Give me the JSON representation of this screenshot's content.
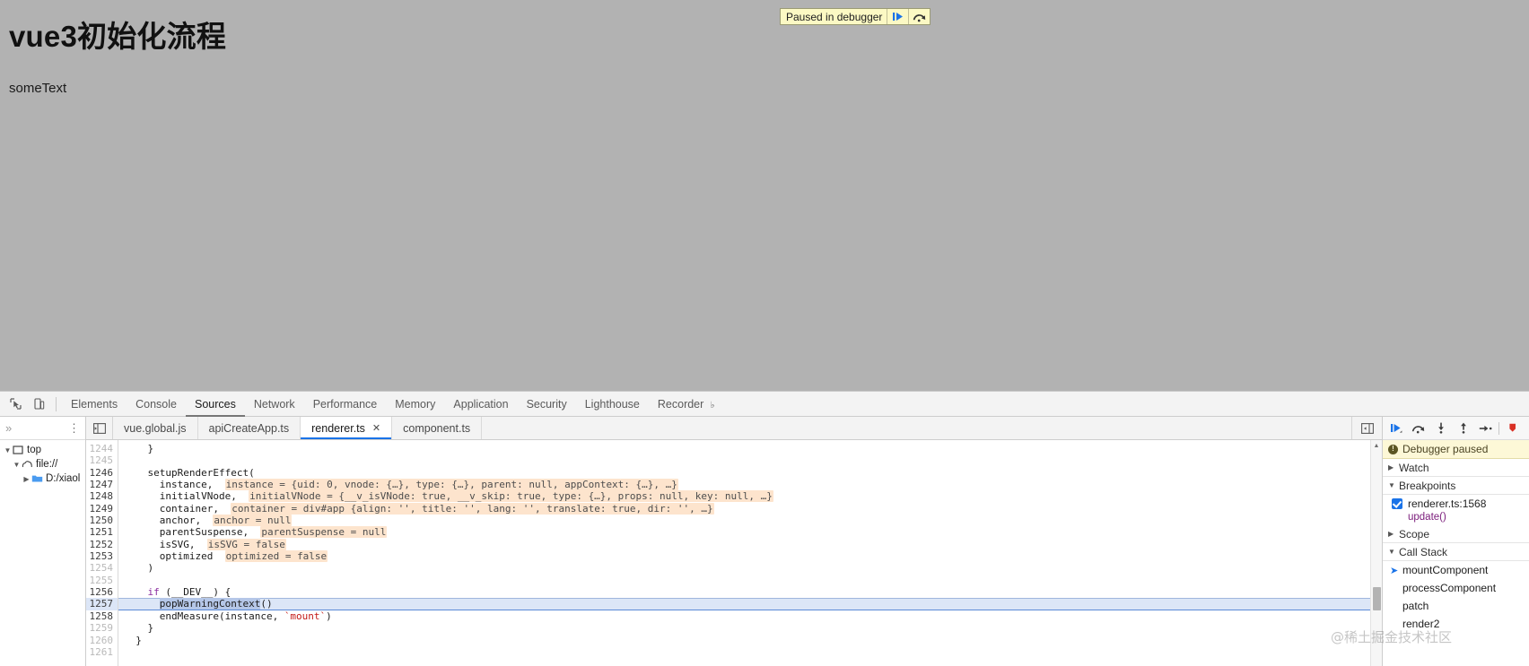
{
  "page": {
    "title": "vue3初始化流程",
    "body_text": "someText",
    "background_color": "#b2b2b2"
  },
  "paused_overlay": {
    "label": "Paused in debugger",
    "resume_icon": "resume-icon",
    "step_over_icon": "step-over-icon",
    "background_color": "#fcf9c4"
  },
  "devtools": {
    "toolbar": {
      "inspect_icon": "inspect-element-icon",
      "device_icon": "device-toolbar-icon",
      "tabs": [
        {
          "label": "Elements",
          "active": false
        },
        {
          "label": "Console",
          "active": false
        },
        {
          "label": "Sources",
          "active": true
        },
        {
          "label": "Network",
          "active": false
        },
        {
          "label": "Performance",
          "active": false
        },
        {
          "label": "Memory",
          "active": false
        },
        {
          "label": "Application",
          "active": false
        },
        {
          "label": "Security",
          "active": false
        },
        {
          "label": "Lighthouse",
          "active": false
        },
        {
          "label": "Recorder",
          "active": false,
          "badge": "experiment-flask-icon"
        }
      ]
    },
    "navigator": {
      "more_icon": "chevron-double-right-icon",
      "menu_icon": "more-options-icon",
      "tree": [
        {
          "label": "top",
          "depth": 0,
          "twisty": "▼",
          "icon": "frame-icon"
        },
        {
          "label": "file://",
          "depth": 1,
          "twisty": "▼",
          "icon": "cloud-icon"
        },
        {
          "label": "D:/xiaol",
          "depth": 2,
          "twisty": "▶",
          "icon": "folder-icon"
        }
      ]
    },
    "editor": {
      "panel_left_icon": "navigator-toggle-icon",
      "panel_right_icon": "debugger-toggle-icon",
      "file_tabs": [
        {
          "label": "vue.global.js",
          "active": false,
          "closable": false
        },
        {
          "label": "apiCreateApp.ts",
          "active": false,
          "closable": false
        },
        {
          "label": "renderer.ts",
          "active": true,
          "closable": true,
          "close_label": "✕"
        },
        {
          "label": "component.ts",
          "active": false,
          "closable": false
        }
      ],
      "current_line": 1257,
      "lines": [
        {
          "n": 1244,
          "dim": true,
          "code": "    }"
        },
        {
          "n": 1245,
          "dim": true,
          "code": ""
        },
        {
          "n": 1246,
          "dim": false,
          "code": "    setupRenderEffect("
        },
        {
          "n": 1247,
          "dim": false,
          "code": "      instance,",
          "value": "instance = {uid: 0, vnode: {…}, type: {…}, parent: null, appContext: {…}, …}"
        },
        {
          "n": 1248,
          "dim": false,
          "code": "      initialVNode,",
          "value": "initialVNode = {__v_isVNode: true, __v_skip: true, type: {…}, props: null, key: null, …}"
        },
        {
          "n": 1249,
          "dim": false,
          "code": "      container,",
          "value": "container = div#app {align: '', title: '', lang: '', translate: true, dir: '', …}"
        },
        {
          "n": 1250,
          "dim": false,
          "code": "      anchor,",
          "value": "anchor = null"
        },
        {
          "n": 1251,
          "dim": false,
          "code": "      parentSuspense,",
          "value": "parentSuspense = null"
        },
        {
          "n": 1252,
          "dim": false,
          "code": "      isSVG,",
          "value": "isSVG = false"
        },
        {
          "n": 1253,
          "dim": false,
          "code": "      optimized",
          "value": "optimized = false"
        },
        {
          "n": 1254,
          "dim": true,
          "code": "    )"
        },
        {
          "n": 1255,
          "dim": true,
          "code": ""
        },
        {
          "n": 1256,
          "dim": false,
          "code": "    if (__DEV__) {"
        },
        {
          "n": 1257,
          "dim": false,
          "code": "      popWarningContext()",
          "current": true,
          "selection": "popWarningContext"
        },
        {
          "n": 1258,
          "dim": false,
          "code": "      endMeasure(instance, `mount`)"
        },
        {
          "n": 1259,
          "dim": true,
          "code": "    }"
        },
        {
          "n": 1260,
          "dim": true,
          "code": "  }"
        },
        {
          "n": 1261,
          "dim": true,
          "code": ""
        }
      ]
    },
    "debugger_sidebar": {
      "toolbar_buttons": [
        {
          "name": "resume-script-execution-icon"
        },
        {
          "name": "step-over-next-function-call-icon"
        },
        {
          "name": "step-into-next-function-call-icon"
        },
        {
          "name": "step-out-of-current-function-icon"
        },
        {
          "name": "step-icon"
        },
        {
          "name": "deactivate-breakpoints-icon"
        }
      ],
      "status": {
        "label": "Debugger paused",
        "icon": "info-icon",
        "background_color": "#fdf8d7"
      },
      "sections": [
        {
          "label": "Watch",
          "expanded": false,
          "twisty": "▶"
        },
        {
          "label": "Breakpoints",
          "expanded": true,
          "twisty": "▼"
        },
        {
          "label": "Scope",
          "expanded": false,
          "twisty": "▶"
        },
        {
          "label": "Call Stack",
          "expanded": true,
          "twisty": "▼"
        }
      ],
      "breakpoints": [
        {
          "checked": true,
          "location": "renderer.ts:1568",
          "snippet": "update()"
        }
      ],
      "call_stack": [
        {
          "name": "mountComponent",
          "current": true
        },
        {
          "name": "processComponent",
          "current": false
        },
        {
          "name": "patch",
          "current": false
        },
        {
          "name": "render2",
          "current": false
        }
      ]
    }
  },
  "watermark": {
    "text": "@稀土掘金技术社区"
  }
}
